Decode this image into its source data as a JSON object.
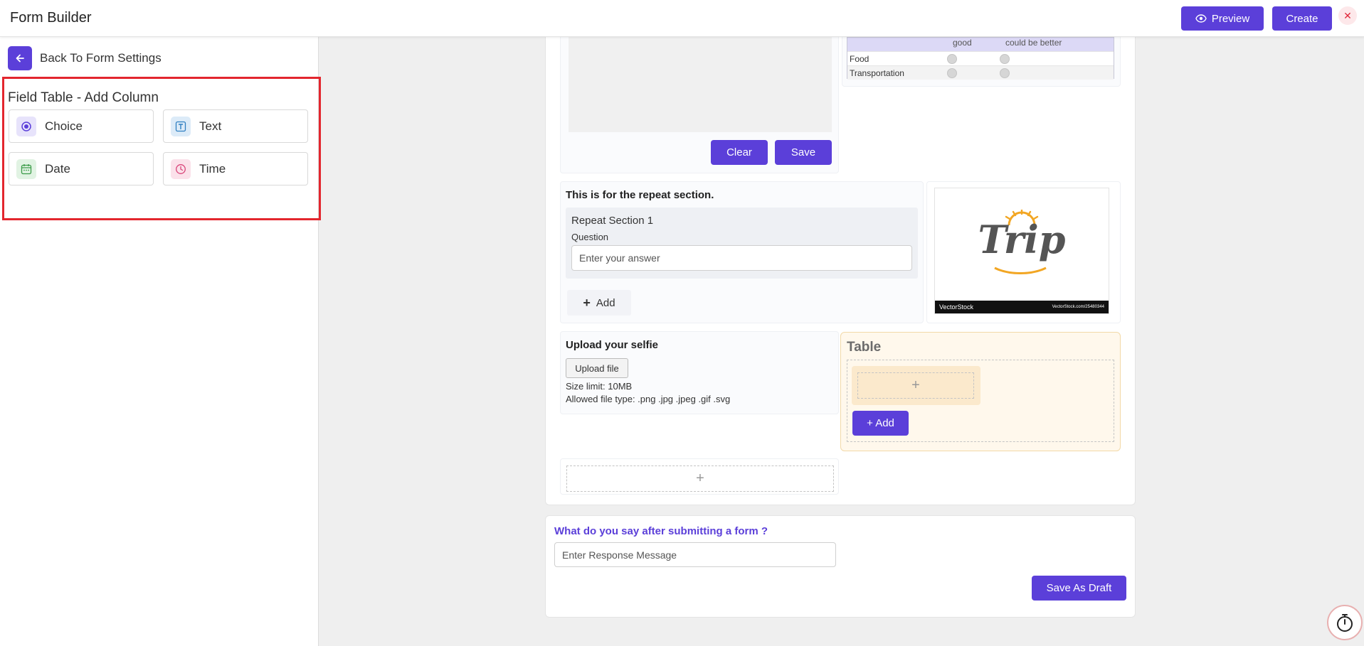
{
  "header": {
    "title": "Form Builder",
    "preview_label": "Preview",
    "create_label": "Create",
    "close_symbol": "✕"
  },
  "sidebar": {
    "back_label": "Back To Form Settings",
    "section_title": "Field Table - Add Column",
    "fields": [
      {
        "label": "Choice",
        "icon": "radio-icon"
      },
      {
        "label": "Text",
        "icon": "text-icon"
      },
      {
        "label": "Date",
        "icon": "calendar-icon"
      },
      {
        "label": "Time",
        "icon": "clock-icon"
      }
    ]
  },
  "signature": {
    "clear_label": "Clear",
    "save_label": "Save"
  },
  "rating": {
    "columns": [
      "good",
      "could be better"
    ],
    "rows": [
      "Food",
      "Transportation"
    ]
  },
  "repeat": {
    "heading": "This is for the repeat section.",
    "section_title": "Repeat Section 1",
    "question_label": "Question",
    "answer_placeholder": "Enter your answer",
    "add_label": "Add"
  },
  "image": {
    "logo_text": "Trip",
    "footer_left": "VectorStock",
    "footer_right": "VectorStock.com/25480344"
  },
  "upload": {
    "heading": "Upload your selfie",
    "button_label": "Upload file",
    "size_limit": "Size limit: 10MB",
    "allowed_types": "Allowed file type: .png .jpg .jpeg .gif .svg"
  },
  "table": {
    "title": "Table",
    "add_label": "+ Add",
    "plus": "+"
  },
  "empty_slot": {
    "plus": "+"
  },
  "response": {
    "question": "What do you say after submitting a form ?",
    "placeholder": "Enter Response Message",
    "save_draft_label": "Save As Draft"
  },
  "colors": {
    "primary": "#5b3fd9",
    "highlight_border": "#e3262e",
    "response_question": "#5b3fd9",
    "table_bg": "#fff8ec"
  }
}
